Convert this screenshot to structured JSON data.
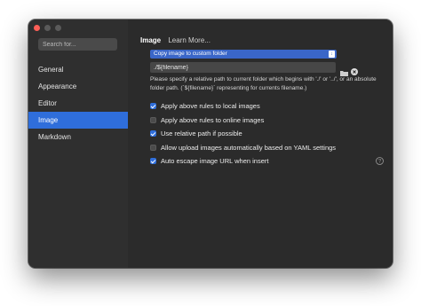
{
  "search": {
    "placeholder": "Search for..."
  },
  "sidebar": {
    "items": [
      {
        "label": "General",
        "active": false
      },
      {
        "label": "Appearance",
        "active": false
      },
      {
        "label": "Editor",
        "active": false
      },
      {
        "label": "Image",
        "active": true
      },
      {
        "label": "Markdown",
        "active": false
      }
    ]
  },
  "main": {
    "title": "Image",
    "learn_more": "Learn More...",
    "action_select": "Copy image to custom folder",
    "path_value": "./${filename}",
    "hint": "Please specify a relative path to current folder which begins with './' or '../', or an absolute folder path. (`${filename}` representing for currents filename.)",
    "options": [
      {
        "label": "Apply above rules to local images",
        "checked": true
      },
      {
        "label": "Apply above rules to online images",
        "checked": false
      },
      {
        "label": "Use relative path if possible",
        "checked": true
      },
      {
        "label": "Allow upload images automatically based on YAML settings",
        "checked": false
      },
      {
        "label": "Auto escape image URL when insert",
        "checked": true
      }
    ]
  },
  "icons": {
    "folder": "folder-icon",
    "clear": "clear-icon",
    "help": "help-icon",
    "chevron": "chevron-updown-icon"
  },
  "colors": {
    "accent": "#2f6edb",
    "window_bg": "#2b2b2b",
    "sidebar_bg": "#2f2f2f",
    "close_button": "#ff5f57"
  }
}
